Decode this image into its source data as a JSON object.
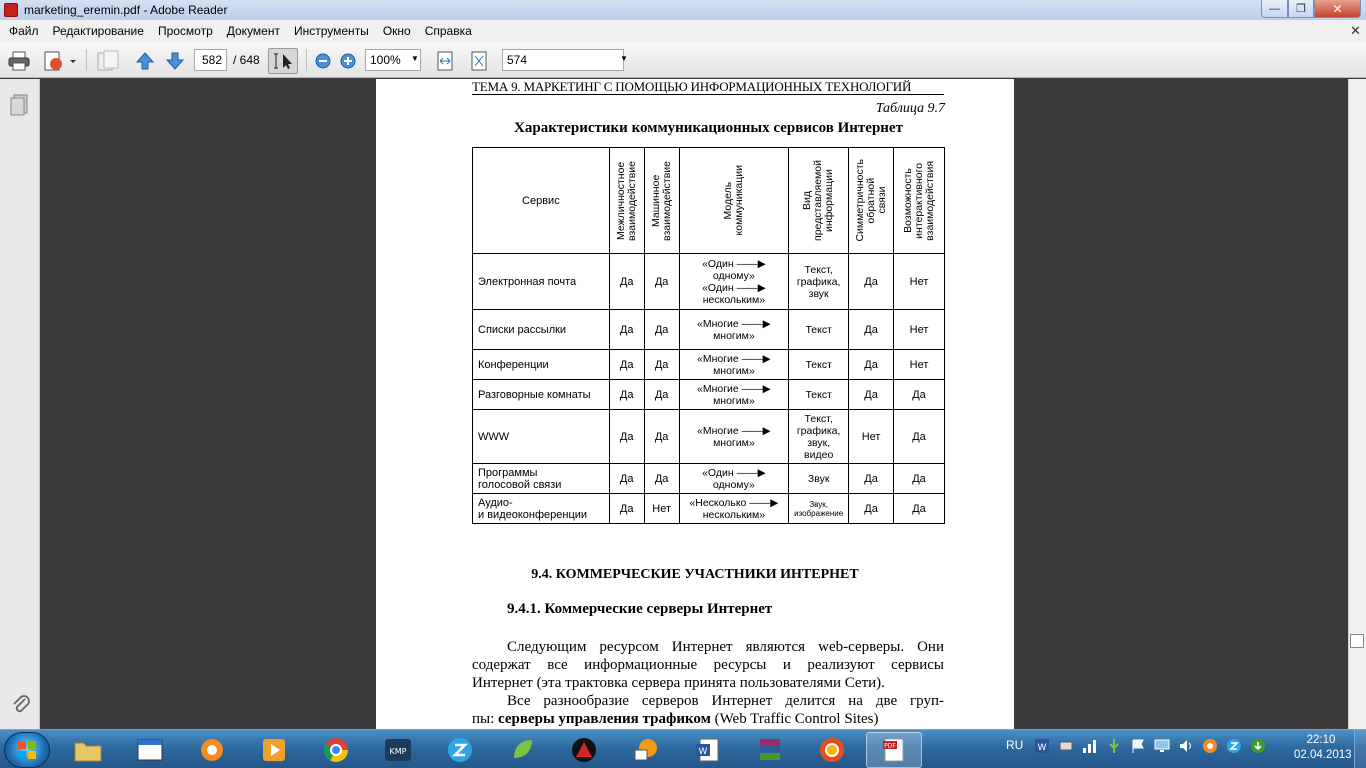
{
  "window": {
    "title": "marketing_eremin.pdf - Adobe Reader"
  },
  "menu": [
    "Файл",
    "Редактирование",
    "Просмотр",
    "Документ",
    "Инструменты",
    "Окно",
    "Справка"
  ],
  "toolbar": {
    "page_current": "582",
    "page_total": "/ 648",
    "zoom": "100%",
    "search_value": "574"
  },
  "page": {
    "running_head": "ТЕМА 9. МАРКЕТИНГ С ПОМОЩЬЮ ИНФОРМАЦИОННЫХ ТЕХНОЛОГИЙ",
    "table_number": "Таблица 9.7",
    "table_caption": "Характеристики коммуникационных сервисов Интернет",
    "section_heading": "9.4. КОММЕРЧЕСКИЕ УЧАСТНИКИ ИНТЕРНЕТ",
    "subsection_heading": "9.4.1. Коммерческие серверы Интернет",
    "para1_lines": [
      "Следующим ресурсом Интернет являются web-серверы. Они",
      "содержат все информационные ресурсы и реализуют сервисы",
      "Интернет (эта трактовка сервера принята пользователями Сети)."
    ],
    "para2_line1": "Все разнообразие серверов Интернет делится на две груп-",
    "para2_line2_prefix": "пы: ",
    "para2_line2_bold": "серверы управления трафиком",
    "para2_line2_suffix": " (Web Traffic Control Sites)"
  },
  "table": {
    "header_service": "Сервис",
    "headers_vertical": [
      "Межличностное\nвзаимодействие",
      "Машинное\nвзаимодействие",
      "Модель\nкоммуникации",
      "Вид\nпредставляемой\nинформации",
      "Симметричность\nобратной\nсвязи",
      "Возможность\nинтерактивного\nвзаимодействия"
    ],
    "rows": [
      {
        "service": "Электронная почта",
        "c1": "Да",
        "c2": "Да",
        "model": "«Один ——▶\nодному»\n«Один ——▶\nнескольким»",
        "kind": "Текст,\nграфика,\nзвук",
        "c5": "Да",
        "c6": "Нет"
      },
      {
        "service": "Списки рассылки",
        "c1": "Да",
        "c2": "Да",
        "model": "«Многие ——▶\nмногим»",
        "kind": "Текст",
        "c5": "Да",
        "c6": "Нет"
      },
      {
        "service": "Конференции",
        "c1": "Да",
        "c2": "Да",
        "model": "«Многие ——▶\nмногим»",
        "kind": "Текст",
        "c5": "Да",
        "c6": "Нет"
      },
      {
        "service": "Разговорные комнаты",
        "c1": "Да",
        "c2": "Да",
        "model": "«Многие ——▶\nмногим»",
        "kind": "Текст",
        "c5": "Да",
        "c6": "Да"
      },
      {
        "service": "WWW",
        "c1": "Да",
        "c2": "Да",
        "model": "«Многие ——▶\nмногим»",
        "kind": "Текст,\nграфика,\nзвук,\nвидео",
        "c5": "Нет",
        "c6": "Да"
      },
      {
        "service": "Программы\nголосовой связи",
        "c1": "Да",
        "c2": "Да",
        "model": "«Один ——▶\nодному»",
        "kind": "Звук",
        "c5": "Да",
        "c6": "Да"
      },
      {
        "service": "Аудио-\nи видеоконференции",
        "c1": "Да",
        "c2": "Нет",
        "model": "«Несколько ——▶\nнескольким»",
        "kind": "Звук,\nизображение",
        "c5": "Да",
        "c6": "Да"
      }
    ]
  },
  "taskbar": {
    "language": "RU",
    "time": "22:10",
    "date": "02.04.2013"
  },
  "colors": {
    "taskbar": "#2d6aa0",
    "titlebar": "#c9daf0",
    "page_bg": "#ffffff",
    "viewer_bg": "#3a3a3a"
  }
}
